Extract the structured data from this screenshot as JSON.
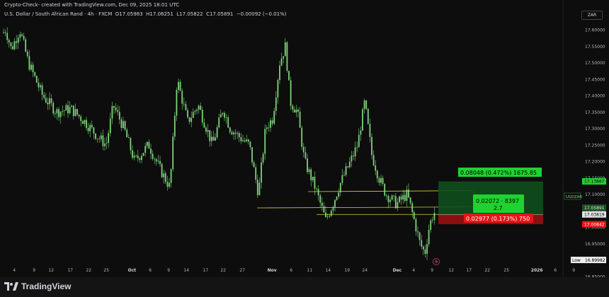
{
  "header": {
    "title": "Crypto-Check- created with TradingView.com, Dec 09, 2025 18:01 UTC"
  },
  "ticker": {
    "symbol": "U.S. Dollar / South African Rand · 4h · FXCM",
    "open": "O17.05983",
    "high": "H17.06251",
    "low": "L17.05822",
    "close": "C17.05891",
    "change": "−0.00092 (−0.01%)"
  },
  "currency": "ZAR",
  "price_axis": {
    "labels": [
      "17.60000",
      "17.55000",
      "17.50000",
      "17.45000",
      "17.40000",
      "17.35000",
      "17.30000",
      "17.25000",
      "17.20000",
      "17.15000",
      "17.10000",
      "17.05000",
      "17.00000",
      "16.95000",
      "16.90000",
      "16.85000"
    ],
    "tags": {
      "target": "17.13867",
      "current_symbol": "USDZAR",
      "current": "17.05891",
      "countdown": "03:58:14",
      "entry": "17.03819",
      "stop": "17.00842",
      "low_label": "Low",
      "low_value": "16.89982"
    }
  },
  "time_axis": {
    "labels": [
      "4",
      "9",
      "12",
      "17",
      "22",
      "25",
      "Oct",
      "6",
      "9",
      "14",
      "17",
      "22",
      "27",
      "Nov",
      "6",
      "11",
      "14",
      "19",
      "24",
      "Dec",
      "4",
      "9",
      "12",
      "17",
      "22",
      "25",
      "2026",
      "6",
      "9"
    ]
  },
  "position": {
    "profit_label": "0.08048 (0.472%) 1675.85",
    "mid_label_1": "0.02072 · 8397",
    "mid_label_2": "2.7",
    "loss_label": "0.02977 (0.173%) 750"
  },
  "brand": {
    "name": "TradingView"
  },
  "colors": {
    "background": "#0d0d0d",
    "candle": "#7ed37a",
    "profit_zone": "#0e4f1c",
    "loss_zone": "#8a0f10",
    "profit_label_bg": "#1fd230",
    "loss_label_bg": "#e41616",
    "trendline": "#d8d040"
  },
  "chart_data": {
    "type": "candlestick",
    "symbol": "USDZAR",
    "interval": "4h",
    "ylim": [
      16.84,
      17.63
    ],
    "points": [
      [
        0,
        17.58
      ],
      [
        8,
        17.6
      ],
      [
        16,
        17.54
      ],
      [
        28,
        17.6
      ],
      [
        40,
        17.5
      ],
      [
        60,
        17.4
      ],
      [
        80,
        17.35
      ],
      [
        100,
        17.36
      ],
      [
        120,
        17.32
      ],
      [
        140,
        17.27
      ],
      [
        150,
        17.25
      ],
      [
        160,
        17.37
      ],
      [
        175,
        17.3
      ],
      [
        190,
        17.2
      ],
      [
        210,
        17.25
      ],
      [
        225,
        17.18
      ],
      [
        240,
        17.12
      ],
      [
        250,
        17.45
      ],
      [
        265,
        17.32
      ],
      [
        280,
        17.37
      ],
      [
        300,
        17.25
      ],
      [
        315,
        17.36
      ],
      [
        325,
        17.3
      ],
      [
        340,
        17.27
      ],
      [
        352,
        17.25
      ],
      [
        365,
        17.1
      ],
      [
        375,
        17.3
      ],
      [
        385,
        17.33
      ],
      [
        395,
        17.5
      ],
      [
        403,
        17.55
      ],
      [
        410,
        17.38
      ],
      [
        420,
        17.35
      ],
      [
        430,
        17.2
      ],
      [
        445,
        17.12
      ],
      [
        460,
        17.02
      ],
      [
        470,
        17.07
      ],
      [
        480,
        17.13
      ],
      [
        495,
        17.2
      ],
      [
        505,
        17.25
      ],
      [
        515,
        17.38
      ],
      [
        525,
        17.22
      ],
      [
        535,
        17.15
      ],
      [
        545,
        17.1
      ],
      [
        560,
        17.07
      ],
      [
        575,
        17.1
      ],
      [
        585,
        17.02
      ],
      [
        593,
        16.95
      ],
      [
        600,
        16.92
      ],
      [
        605,
        16.99
      ],
      [
        610,
        17.03
      ],
      [
        615,
        17.05
      ]
    ],
    "trendline": [
      17.06,
      17.11
    ],
    "position": {
      "entry": 17.03819,
      "target": 17.13867,
      "stop": 17.00842
    }
  }
}
